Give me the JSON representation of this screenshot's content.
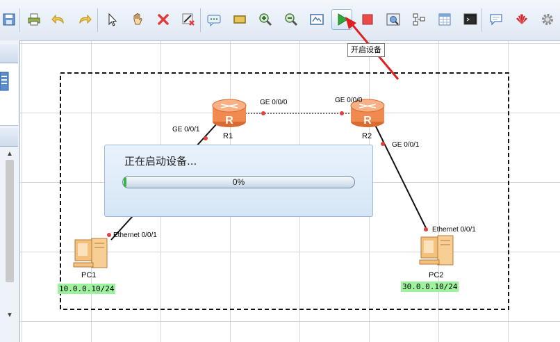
{
  "toolbar": {
    "buttons": [
      {
        "icon": "save-icon"
      },
      {
        "icon": "print-icon"
      },
      {
        "icon": "undo-icon"
      },
      {
        "icon": "redo-icon"
      },
      {
        "icon": "select-cursor-icon"
      },
      {
        "icon": "hand-pan-icon"
      },
      {
        "icon": "delete-icon"
      },
      {
        "icon": "delete-connection-icon"
      },
      {
        "icon": "text-note-icon"
      },
      {
        "icon": "rectangle-icon"
      },
      {
        "icon": "zoom-in-icon"
      },
      {
        "icon": "zoom-out-icon"
      },
      {
        "icon": "fit-view-icon"
      },
      {
        "icon": "start-device-icon"
      },
      {
        "icon": "stop-device-icon"
      },
      {
        "icon": "capture-data-icon"
      },
      {
        "icon": "topology-icon"
      },
      {
        "icon": "table-icon"
      },
      {
        "icon": "console-icon"
      },
      {
        "icon": "chat-icon"
      },
      {
        "icon": "huawei-logo-icon"
      },
      {
        "icon": "settings-gear-icon"
      }
    ],
    "tooltip": "开启设备"
  },
  "topology": {
    "routers": [
      {
        "name": "R1"
      },
      {
        "name": "R2"
      }
    ],
    "pcs": [
      {
        "name": "PC1",
        "ip": "10.0.0.10/24"
      },
      {
        "name": "PC2",
        "ip": "30.0.0.10/24"
      }
    ],
    "ports": {
      "r1_to_pc1": "GE 0/0/1",
      "r1_to_r2": "GE 0/0/0",
      "r2_to_r1": "GE 0/0/0",
      "r2_to_pc2": "GE 0/0/1",
      "pc1_port": "Ethernet 0/0/1",
      "pc2_port": "Ethernet 0/0/1"
    }
  },
  "dialog": {
    "message": "正在启动设备...",
    "progress_text": "0%",
    "progress": 0.01
  },
  "colors": {
    "accent": "#3cb34a",
    "link_port": "#e04040",
    "ip_label_bg": "#9ef29e",
    "arrow": "#e02020",
    "router": "#f08a50"
  }
}
